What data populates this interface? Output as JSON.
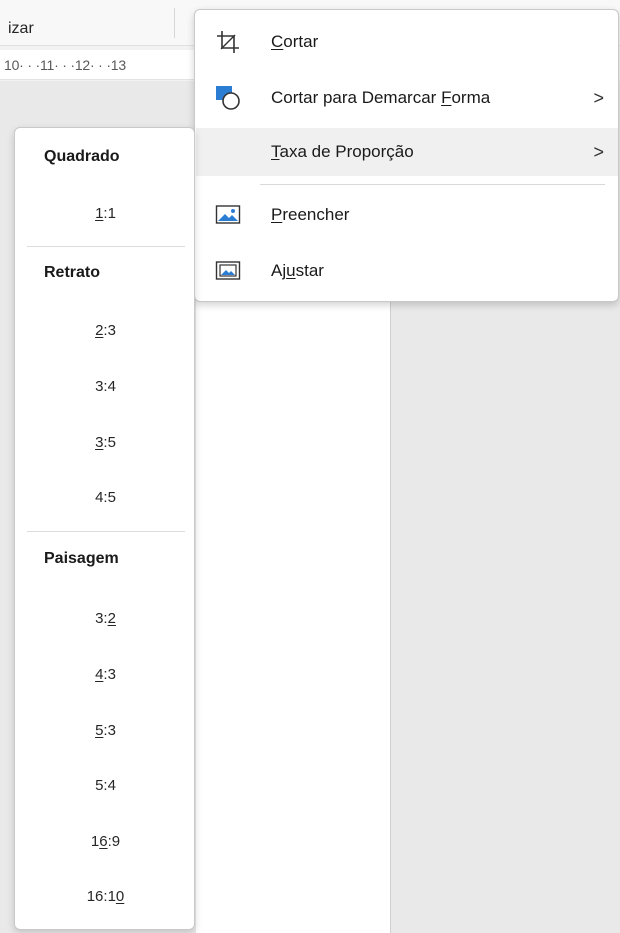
{
  "ribbon": {
    "label": "izar"
  },
  "ruler": {
    "text": "10· · ·11· · ·12· · ·13"
  },
  "menu": {
    "items": [
      {
        "pre": "",
        "key": "C",
        "post": "ortar",
        "icon": "crop-icon",
        "has_submenu": false
      },
      {
        "pre": "Cortar para Demarcar ",
        "key": "F",
        "post": "orma",
        "icon": "crop-to-shape-icon",
        "has_submenu": true,
        "arrow": ">"
      },
      {
        "pre": "",
        "key": "T",
        "post": "axa de Proporção",
        "icon": "",
        "has_submenu": true,
        "arrow": ">"
      },
      {
        "pre": "",
        "key": "P",
        "post": "reencher",
        "icon": "fill-icon",
        "has_submenu": false
      },
      {
        "pre": "Aj",
        "key": "u",
        "post": "star",
        "icon": "fit-icon",
        "has_submenu": false
      }
    ]
  },
  "aspect_ratio": {
    "groups": [
      {
        "header": "Quadrado",
        "items": [
          {
            "pre": "",
            "key": "1",
            "post": ":1"
          }
        ]
      },
      {
        "header": "Retrato",
        "items": [
          {
            "pre": "",
            "key": "2",
            "post": ":3"
          },
          {
            "pre": "3:4",
            "key": "",
            "post": ""
          },
          {
            "pre": "",
            "key": "3",
            "post": ":5"
          },
          {
            "pre": "4:5",
            "key": "",
            "post": ""
          }
        ]
      },
      {
        "header": "Paisagem",
        "items": [
          {
            "pre": "3:",
            "key": "2",
            "post": ""
          },
          {
            "pre": "",
            "key": "4",
            "post": ":3"
          },
          {
            "pre": "",
            "key": "5",
            "post": ":3"
          },
          {
            "pre": "5:4",
            "key": "",
            "post": ""
          },
          {
            "pre": "1",
            "key": "6",
            "post": ":9"
          },
          {
            "pre": "16:1",
            "key": "0",
            "post": ""
          }
        ]
      }
    ]
  },
  "colors": {
    "accent_blue": "#2b7cd3",
    "hover_bg": "#f0f0f0"
  }
}
